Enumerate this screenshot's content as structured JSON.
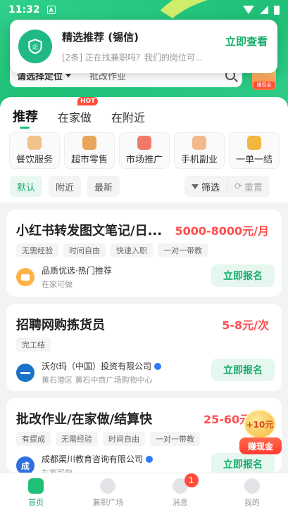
{
  "status_bar": {
    "time": "11:32",
    "sim_label": "A"
  },
  "notification": {
    "title": "精选推荐 (锡信)",
    "subtitle": "[2条] 正在找兼职吗？我们的岗位可...",
    "action": "立即查看"
  },
  "search": {
    "location": "请选择定位",
    "placeholder": "批改作业",
    "badge_label": "赚现金"
  },
  "tabs": [
    {
      "label": "推荐",
      "active": true
    },
    {
      "label": "在家做",
      "badge": "HOT"
    },
    {
      "label": "在附近"
    }
  ],
  "categories": [
    {
      "label": "餐饮服务",
      "icon": "chef-icon",
      "color": "#f2c28b"
    },
    {
      "label": "超市零售",
      "icon": "shopping-bag-icon",
      "color": "#e9a55a"
    },
    {
      "label": "市场推广",
      "icon": "megaphone-icon",
      "color": "#f07a6a"
    },
    {
      "label": "手机副业",
      "icon": "phone-icon",
      "color": "#f4b98a"
    },
    {
      "label": "一单一结",
      "icon": "coins-icon",
      "color": "#f2b73e"
    }
  ],
  "filters": {
    "sort": [
      {
        "label": "默认",
        "active": true
      },
      {
        "label": "附近"
      },
      {
        "label": "最新"
      }
    ],
    "filter_label": "筛选",
    "reset_label": "重置"
  },
  "jobs": [
    {
      "title": "小红书转发图文笔记/日...",
      "pay": "5000-8000元/月",
      "tags": [
        "无需经验",
        "时间自由",
        "快速入职",
        "一对一带教"
      ],
      "company": "品质优选·热门推荐",
      "location": "在家可做",
      "avatar_color": "#ffb347",
      "avatar_text": "",
      "verified": false,
      "apply": "立即报名"
    },
    {
      "title": "招聘网购拣货员",
      "pay": "5-8元/次",
      "tags": [
        "完工结"
      ],
      "company": "沃尔玛（中国）投资有限公司",
      "location": "黄石港区 黄石中商广场购物中心",
      "avatar_color": "#1a73c8",
      "avatar_text": "",
      "verified": true,
      "apply": "立即报名"
    },
    {
      "title": "批改作业/在家做/结算快",
      "pay": "25-60元",
      "tags": [
        "有提成",
        "无需经验",
        "时间自由",
        "一对一带教"
      ],
      "company": "成都渠川教育咨询有限公司",
      "location": "在家可做",
      "avatar_color": "#2f6fe0",
      "avatar_text": "成",
      "verified": true,
      "apply": "立即报名"
    }
  ],
  "reward": {
    "amount": "+10元",
    "label": "赚现金"
  },
  "bottom_nav": [
    {
      "label": "首页",
      "active": true,
      "icon": "home-icon"
    },
    {
      "label": "兼职广场",
      "icon": "compass-icon"
    },
    {
      "label": "消息",
      "icon": "chat-icon",
      "badge": "1"
    },
    {
      "label": "我的",
      "icon": "profile-icon"
    }
  ]
}
